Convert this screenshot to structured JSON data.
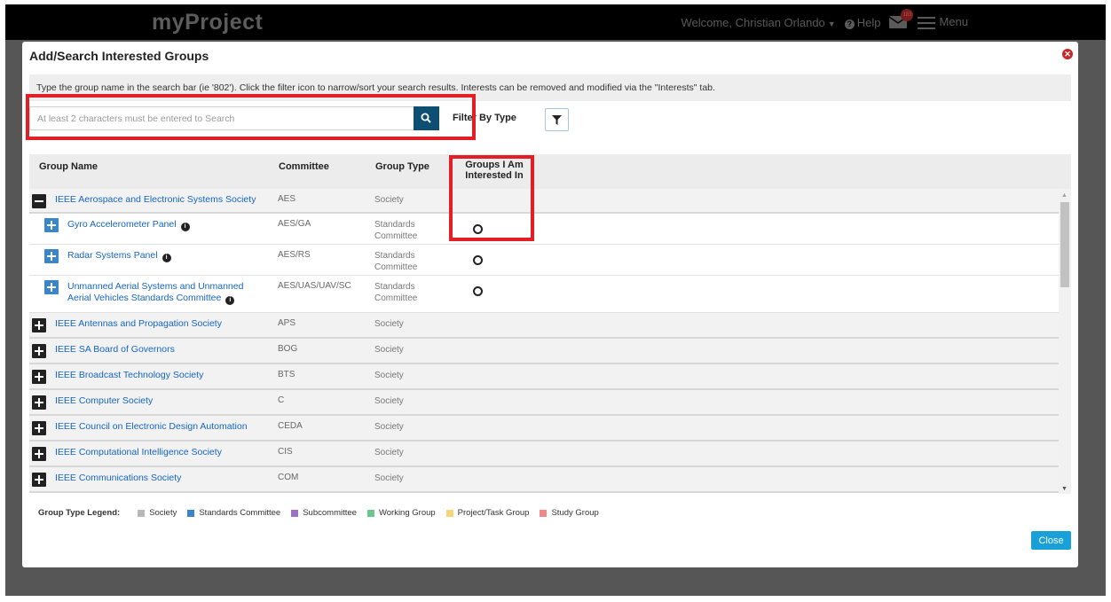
{
  "topbar": {
    "brand": "myProject",
    "welcome": "Welcome, Christian Orlando",
    "help": "Help",
    "mail_badge": "183",
    "menu": "Menu"
  },
  "modal": {
    "title": "Add/Search Interested Groups",
    "instructions": "Type the group name in the search bar (ie '802'). Click the filter icon to narrow/sort your search results. Interests can be removed and modified via the \"Interests\" tab.",
    "search_placeholder": "At least 2 characters must be entered to Search",
    "filter_label": "Filter By Type",
    "close_label": "Close"
  },
  "table": {
    "headers": {
      "group_name": "Group Name",
      "committee": "Committee",
      "group_type": "Group Type",
      "interested_line1": "Groups I Am",
      "interested_line2": "Interested In"
    },
    "parent_row": {
      "name": "IEEE Aerospace and Electronic Systems Society",
      "committee": "AES",
      "type": "Society"
    },
    "children": [
      {
        "name": "Gyro Accelerometer Panel",
        "committee": "AES/GA",
        "type_line1": "Standards",
        "type_line2": "Committee"
      },
      {
        "name": "Radar Systems Panel",
        "committee": "AES/RS",
        "type_line1": "Standards",
        "type_line2": "Committee"
      },
      {
        "name_line1": "Unmanned Aerial Systems and Unmanned",
        "name_line2": "Aerial Vehicles Standards Committee",
        "committee": "AES/UAS/UAV/SC",
        "type_line1": "Standards",
        "type_line2": "Committee"
      }
    ],
    "rows": [
      {
        "name": "IEEE Antennas and Propagation Society",
        "committee": "APS",
        "type": "Society"
      },
      {
        "name": "IEEE SA Board of Governors",
        "committee": "BOG",
        "type": "Society"
      },
      {
        "name": "IEEE Broadcast Technology Society",
        "committee": "BTS",
        "type": "Society"
      },
      {
        "name": "IEEE Computer Society",
        "committee": "C",
        "type": "Society"
      },
      {
        "name": "IEEE Council on Electronic Design Automation",
        "committee": "CEDA",
        "type": "Society"
      },
      {
        "name": "IEEE Computational Intelligence Society",
        "committee": "CIS",
        "type": "Society"
      },
      {
        "name": "IEEE Communications Society",
        "committee": "COM",
        "type": "Society"
      }
    ]
  },
  "legend": {
    "title": "Group Type Legend:",
    "items": [
      {
        "label": "Society",
        "color": "#b8b8b8"
      },
      {
        "label": "Standards Committee",
        "color": "#3a86c8"
      },
      {
        "label": "Subcommittee",
        "color": "#9b72c4"
      },
      {
        "label": "Working Group",
        "color": "#6cc58a"
      },
      {
        "label": "Project/Task Group",
        "color": "#f5d77a"
      },
      {
        "label": "Study Group",
        "color": "#f08a8a"
      }
    ]
  }
}
